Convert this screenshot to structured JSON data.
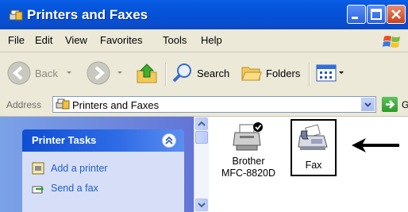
{
  "window": {
    "title": "Printers and Faxes"
  },
  "menu": {
    "items": [
      "File",
      "Edit",
      "View",
      "Favorites",
      "Tools",
      "Help"
    ]
  },
  "toolbar": {
    "back_label": "Back",
    "search_label": "Search",
    "folders_label": "Folders"
  },
  "address": {
    "label": "Address",
    "value": "Printers and Faxes",
    "go_label": "Go"
  },
  "tasks": {
    "title": "Printer Tasks",
    "links": [
      "Add a printer",
      "Send a fax"
    ]
  },
  "items": {
    "printer_name": "Brother\nMFC-8820D",
    "printer_line1": "Brother",
    "printer_line2": "MFC-8820D",
    "fax_name": "Fax"
  },
  "colors": {
    "titlebar": "#0453d8",
    "taskpane": "#7ba2e7",
    "link": "#215dc6"
  }
}
